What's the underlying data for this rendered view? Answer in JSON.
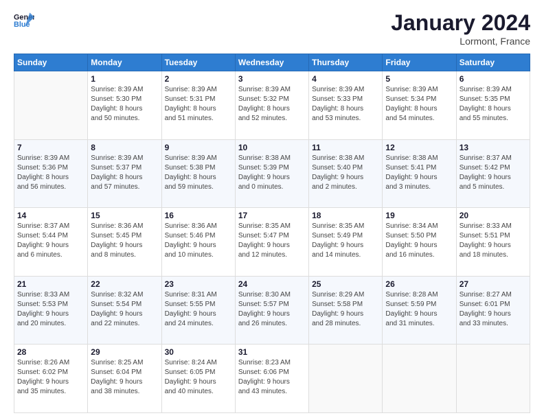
{
  "header": {
    "logo_general": "General",
    "logo_blue": "Blue",
    "month_title": "January 2024",
    "location": "Lormont, France"
  },
  "days_of_week": [
    "Sunday",
    "Monday",
    "Tuesday",
    "Wednesday",
    "Thursday",
    "Friday",
    "Saturday"
  ],
  "weeks": [
    {
      "days": [
        {
          "num": "",
          "info": ""
        },
        {
          "num": "1",
          "info": "Sunrise: 8:39 AM\nSunset: 5:30 PM\nDaylight: 8 hours\nand 50 minutes."
        },
        {
          "num": "2",
          "info": "Sunrise: 8:39 AM\nSunset: 5:31 PM\nDaylight: 8 hours\nand 51 minutes."
        },
        {
          "num": "3",
          "info": "Sunrise: 8:39 AM\nSunset: 5:32 PM\nDaylight: 8 hours\nand 52 minutes."
        },
        {
          "num": "4",
          "info": "Sunrise: 8:39 AM\nSunset: 5:33 PM\nDaylight: 8 hours\nand 53 minutes."
        },
        {
          "num": "5",
          "info": "Sunrise: 8:39 AM\nSunset: 5:34 PM\nDaylight: 8 hours\nand 54 minutes."
        },
        {
          "num": "6",
          "info": "Sunrise: 8:39 AM\nSunset: 5:35 PM\nDaylight: 8 hours\nand 55 minutes."
        }
      ]
    },
    {
      "days": [
        {
          "num": "7",
          "info": "Sunrise: 8:39 AM\nSunset: 5:36 PM\nDaylight: 8 hours\nand 56 minutes."
        },
        {
          "num": "8",
          "info": "Sunrise: 8:39 AM\nSunset: 5:37 PM\nDaylight: 8 hours\nand 57 minutes."
        },
        {
          "num": "9",
          "info": "Sunrise: 8:39 AM\nSunset: 5:38 PM\nDaylight: 8 hours\nand 59 minutes."
        },
        {
          "num": "10",
          "info": "Sunrise: 8:38 AM\nSunset: 5:39 PM\nDaylight: 9 hours\nand 0 minutes."
        },
        {
          "num": "11",
          "info": "Sunrise: 8:38 AM\nSunset: 5:40 PM\nDaylight: 9 hours\nand 2 minutes."
        },
        {
          "num": "12",
          "info": "Sunrise: 8:38 AM\nSunset: 5:41 PM\nDaylight: 9 hours\nand 3 minutes."
        },
        {
          "num": "13",
          "info": "Sunrise: 8:37 AM\nSunset: 5:42 PM\nDaylight: 9 hours\nand 5 minutes."
        }
      ]
    },
    {
      "days": [
        {
          "num": "14",
          "info": "Sunrise: 8:37 AM\nSunset: 5:44 PM\nDaylight: 9 hours\nand 6 minutes."
        },
        {
          "num": "15",
          "info": "Sunrise: 8:36 AM\nSunset: 5:45 PM\nDaylight: 9 hours\nand 8 minutes."
        },
        {
          "num": "16",
          "info": "Sunrise: 8:36 AM\nSunset: 5:46 PM\nDaylight: 9 hours\nand 10 minutes."
        },
        {
          "num": "17",
          "info": "Sunrise: 8:35 AM\nSunset: 5:47 PM\nDaylight: 9 hours\nand 12 minutes."
        },
        {
          "num": "18",
          "info": "Sunrise: 8:35 AM\nSunset: 5:49 PM\nDaylight: 9 hours\nand 14 minutes."
        },
        {
          "num": "19",
          "info": "Sunrise: 8:34 AM\nSunset: 5:50 PM\nDaylight: 9 hours\nand 16 minutes."
        },
        {
          "num": "20",
          "info": "Sunrise: 8:33 AM\nSunset: 5:51 PM\nDaylight: 9 hours\nand 18 minutes."
        }
      ]
    },
    {
      "days": [
        {
          "num": "21",
          "info": "Sunrise: 8:33 AM\nSunset: 5:53 PM\nDaylight: 9 hours\nand 20 minutes."
        },
        {
          "num": "22",
          "info": "Sunrise: 8:32 AM\nSunset: 5:54 PM\nDaylight: 9 hours\nand 22 minutes."
        },
        {
          "num": "23",
          "info": "Sunrise: 8:31 AM\nSunset: 5:55 PM\nDaylight: 9 hours\nand 24 minutes."
        },
        {
          "num": "24",
          "info": "Sunrise: 8:30 AM\nSunset: 5:57 PM\nDaylight: 9 hours\nand 26 minutes."
        },
        {
          "num": "25",
          "info": "Sunrise: 8:29 AM\nSunset: 5:58 PM\nDaylight: 9 hours\nand 28 minutes."
        },
        {
          "num": "26",
          "info": "Sunrise: 8:28 AM\nSunset: 5:59 PM\nDaylight: 9 hours\nand 31 minutes."
        },
        {
          "num": "27",
          "info": "Sunrise: 8:27 AM\nSunset: 6:01 PM\nDaylight: 9 hours\nand 33 minutes."
        }
      ]
    },
    {
      "days": [
        {
          "num": "28",
          "info": "Sunrise: 8:26 AM\nSunset: 6:02 PM\nDaylight: 9 hours\nand 35 minutes."
        },
        {
          "num": "29",
          "info": "Sunrise: 8:25 AM\nSunset: 6:04 PM\nDaylight: 9 hours\nand 38 minutes."
        },
        {
          "num": "30",
          "info": "Sunrise: 8:24 AM\nSunset: 6:05 PM\nDaylight: 9 hours\nand 40 minutes."
        },
        {
          "num": "31",
          "info": "Sunrise: 8:23 AM\nSunset: 6:06 PM\nDaylight: 9 hours\nand 43 minutes."
        },
        {
          "num": "",
          "info": ""
        },
        {
          "num": "",
          "info": ""
        },
        {
          "num": "",
          "info": ""
        }
      ]
    }
  ]
}
